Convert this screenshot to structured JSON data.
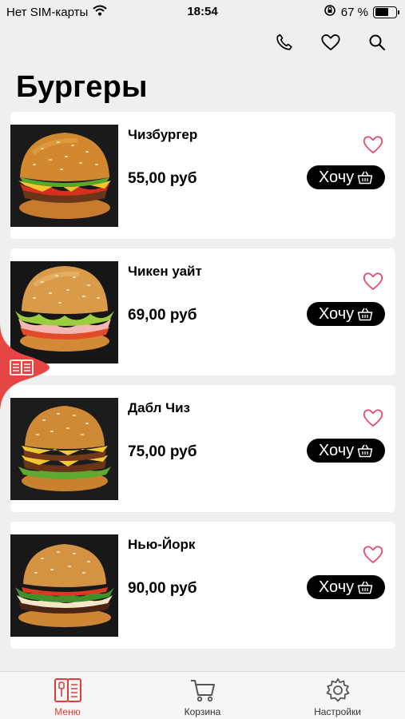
{
  "status_bar": {
    "carrier": "Нет SIM-карты",
    "time": "18:54",
    "battery": "67 %",
    "battery_level": 0.67
  },
  "header": {
    "title": "Бургеры",
    "actions": [
      "phone-icon",
      "heart-icon",
      "search-icon"
    ]
  },
  "products": [
    {
      "name": "Чизбургер",
      "price": "55,00 руб",
      "button": "Хочу"
    },
    {
      "name": "Чикен уайт",
      "price": "69,00 руб",
      "button": "Хочу"
    },
    {
      "name": "Дабл Чиз",
      "price": "75,00 руб",
      "button": "Хочу"
    },
    {
      "name": "Нью-Йорк",
      "price": "90,00 руб",
      "button": "Хочу"
    }
  ],
  "tab_bar": {
    "items": [
      {
        "label": "Меню",
        "icon": "menu-book-icon",
        "active": true
      },
      {
        "label": "Корзина",
        "icon": "cart-icon",
        "active": false
      },
      {
        "label": "Настройки",
        "icon": "gear-icon",
        "active": false
      }
    ]
  },
  "colors": {
    "accent": "#e23b3b",
    "heart": "#e8466a",
    "button": "#000000",
    "background": "#efefef"
  }
}
